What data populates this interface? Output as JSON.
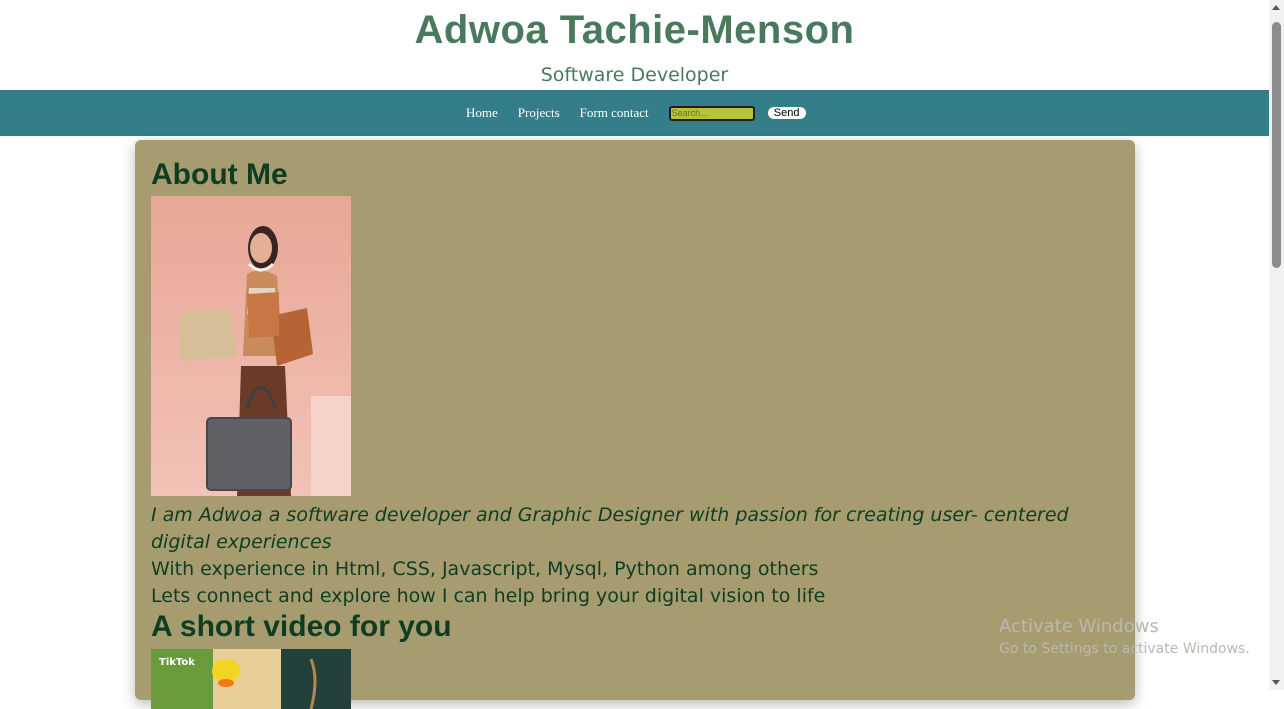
{
  "header": {
    "title": "Adwoa Tachie-Menson",
    "subtitle": "Software Developer"
  },
  "nav": {
    "links": [
      "Home",
      "Projects",
      "Form contact"
    ],
    "search_placeholder": "Search...",
    "send_label": "Send"
  },
  "about": {
    "heading": "About Me",
    "intro": "I am Adwoa a software developer and Graphic Designer with passion for creating user- centered digital experiences",
    "experience": "With experience in Html, CSS, Javascript, Mysql, Python among others",
    "cta": "Lets connect and explore how I can help bring your digital vision to life"
  },
  "video": {
    "heading": "A short video for you",
    "thumbnail_badge": "TikTok"
  },
  "watermark": {
    "title": "Activate Windows",
    "subtitle": "Go to Settings to activate Windows."
  },
  "colors": {
    "title_green": "#4a7a5e",
    "nav_teal": "#337e88",
    "card_khaki": "#a69c70",
    "text_dark_green": "#0f3d22",
    "search_bg": "#b7c43a"
  }
}
